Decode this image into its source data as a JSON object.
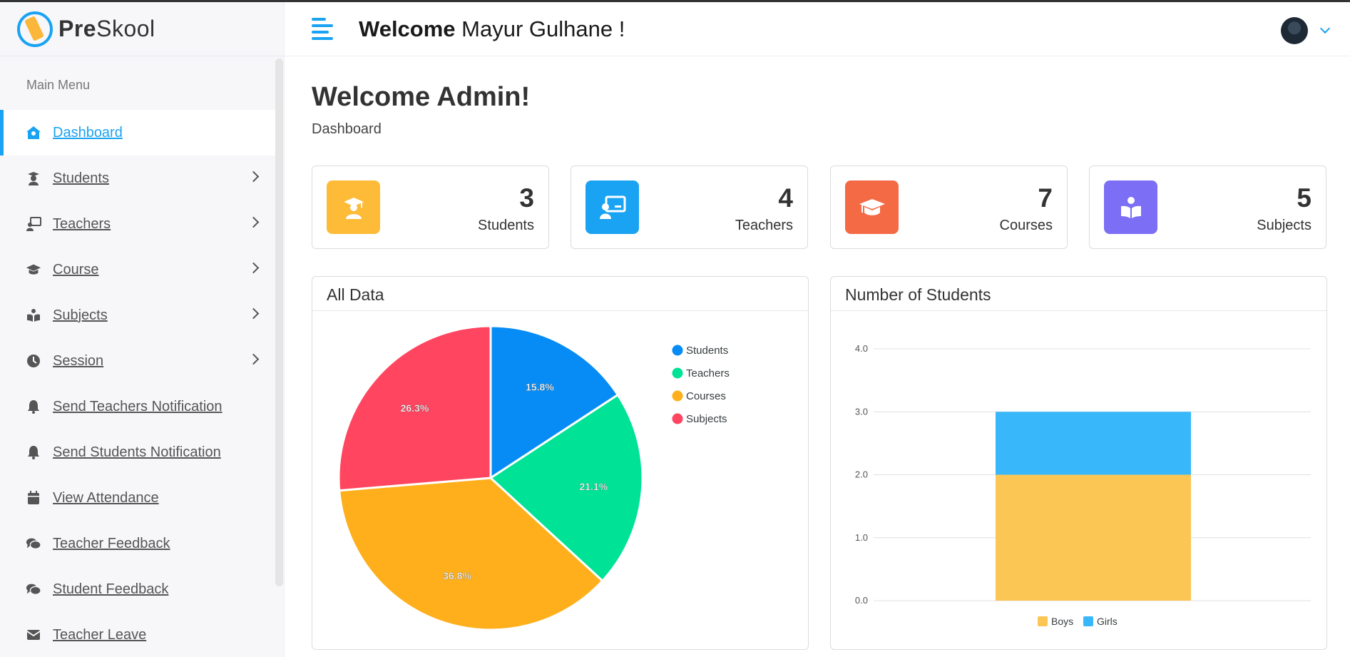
{
  "app": {
    "name_bold": "Pre",
    "name_rest": "Skool"
  },
  "header": {
    "welcome_bold": "Welcome",
    "welcome_name": "Mayur Gulhane !"
  },
  "sidebar": {
    "menu_title": "Main Menu",
    "items": [
      {
        "label": "Dashboard",
        "icon": "home-icon",
        "active": true,
        "chevron": false
      },
      {
        "label": "Students",
        "icon": "student-icon",
        "chevron": true
      },
      {
        "label": "Teachers",
        "icon": "teacher-icon",
        "chevron": true
      },
      {
        "label": "Course",
        "icon": "graduation-cap-icon",
        "chevron": true
      },
      {
        "label": "Subjects",
        "icon": "book-reader-icon",
        "chevron": true
      },
      {
        "label": "Session",
        "icon": "clock-icon",
        "chevron": true
      },
      {
        "label": "Send Teachers Notification",
        "icon": "bell-icon",
        "chevron": false
      },
      {
        "label": "Send Students Notification",
        "icon": "bell-icon",
        "chevron": false
      },
      {
        "label": "View Attendance",
        "icon": "calendar-icon",
        "chevron": false
      },
      {
        "label": "Teacher Feedback",
        "icon": "comments-icon",
        "chevron": false
      },
      {
        "label": "Student Feedback",
        "icon": "comments-icon",
        "chevron": false
      },
      {
        "label": "Teacher Leave",
        "icon": "envelope-icon",
        "chevron": false
      }
    ]
  },
  "page": {
    "title": "Welcome Admin!",
    "breadcrumb": "Dashboard"
  },
  "stats": [
    {
      "value": "3",
      "label": "Students",
      "color": "#fdbb38",
      "icon": "graduate-icon"
    },
    {
      "value": "4",
      "label": "Teachers",
      "color": "#1aa3f2",
      "icon": "teacher-board-icon"
    },
    {
      "value": "7",
      "label": "Courses",
      "color": "#f46a45",
      "icon": "graduation-cap-icon"
    },
    {
      "value": "5",
      "label": "Subjects",
      "color": "#7c6ef5",
      "icon": "book-reader-icon"
    }
  ],
  "cards": {
    "pie_title": "All Data",
    "bar_title": "Number of Students"
  },
  "chart_data": [
    {
      "type": "pie",
      "title": "All Data",
      "labels": [
        "Students",
        "Teachers",
        "Courses",
        "Subjects"
      ],
      "values": [
        3,
        4,
        7,
        5
      ],
      "percent_labels": [
        "15.8%",
        "21.1%",
        "36.8%",
        "26.3%"
      ],
      "colors": [
        "#078cf5",
        "#00e396",
        "#feaf1b",
        "#ff4560"
      ],
      "legend": "right"
    },
    {
      "type": "bar",
      "title": "Number of Students",
      "stacked": true,
      "categories": [
        ""
      ],
      "series": [
        {
          "name": "Boys",
          "values": [
            2
          ],
          "color": "#fcc655"
        },
        {
          "name": "Girls",
          "values": [
            1
          ],
          "color": "#38b8fa"
        }
      ],
      "ylim": [
        0,
        4
      ],
      "yticks": [
        "0.0",
        "1.0",
        "2.0",
        "3.0",
        "4.0"
      ],
      "grid": true,
      "legend": "bottom"
    }
  ]
}
